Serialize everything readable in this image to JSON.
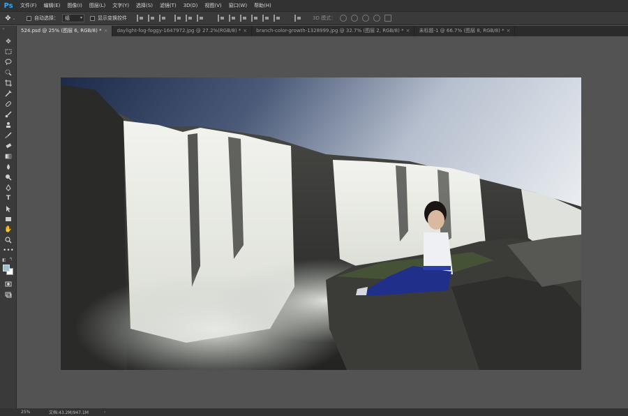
{
  "app": {
    "logo": "Ps"
  },
  "menu": [
    "文件(F)",
    "编辑(E)",
    "图像(I)",
    "图层(L)",
    "文字(Y)",
    "选择(S)",
    "滤镜(T)",
    "3D(D)",
    "视图(V)",
    "窗口(W)",
    "帮助(H)"
  ],
  "options": {
    "auto_select_label": "自动选择：",
    "auto_select_value": "组",
    "show_transform_label": "显示变换控件",
    "mode_3d_label": "3D 模式："
  },
  "tabs": [
    {
      "label": "524.psd @ 25% (图层 6, RGB/8) *",
      "close": "×"
    },
    {
      "label": "daylight-fog-foggy-1647972.jpg @ 27.2%(RGB/8) *",
      "close": "×"
    },
    {
      "label": "branch-color-growth-1328999.jpg @ 32.7% (图层 2, RGB/8) *",
      "close": "×"
    },
    {
      "label": "未标题-1 @ 66.7% (图层 8, RGB/8) *",
      "close": "×"
    }
  ],
  "tools": [
    "move-icon",
    "marquee-icon",
    "lasso-icon",
    "quick-select-icon",
    "crop-icon",
    "eyedropper-icon",
    "healing-brush-icon",
    "brush-icon",
    "clone-stamp-icon",
    "history-brush-icon",
    "eraser-icon",
    "gradient-icon",
    "blur-icon",
    "dodge-icon",
    "pen-icon",
    "type-icon",
    "path-select-icon",
    "rectangle-icon",
    "hand-icon",
    "zoom-icon",
    "more-tools-icon"
  ],
  "colors": {
    "foreground": "#9ac4d6",
    "background": "#ffffff",
    "workspace": "#535353"
  },
  "status": {
    "zoom": "25%",
    "doc": "文档:43.2M/947.1M",
    "more": "›"
  }
}
